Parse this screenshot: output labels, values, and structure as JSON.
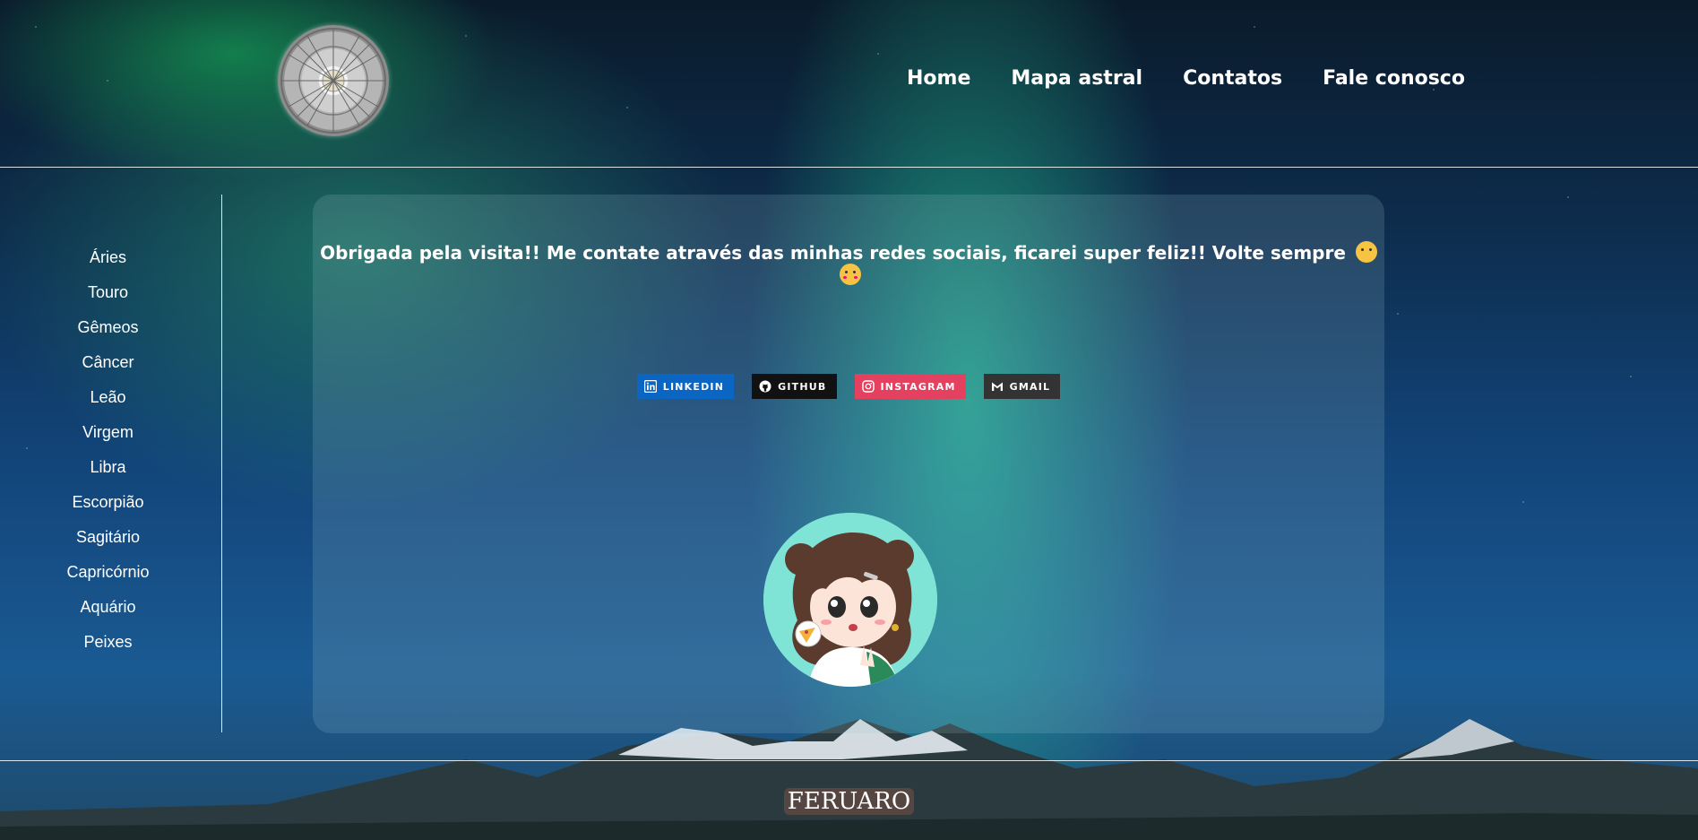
{
  "header": {
    "logo_icon": "zodiac-wheel-icon",
    "nav": [
      {
        "label": "Home"
      },
      {
        "label": "Mapa astral"
      },
      {
        "label": "Contatos"
      },
      {
        "label": "Fale conosco"
      }
    ]
  },
  "sidebar": {
    "items": [
      {
        "label": "Áries"
      },
      {
        "label": "Touro"
      },
      {
        "label": "Gêmeos"
      },
      {
        "label": "Câncer"
      },
      {
        "label": "Leão"
      },
      {
        "label": "Virgem"
      },
      {
        "label": "Libra"
      },
      {
        "label": "Escorpião"
      },
      {
        "label": "Sagitário"
      },
      {
        "label": "Capricórnio"
      },
      {
        "label": "Aquário"
      },
      {
        "label": "Peixes"
      }
    ]
  },
  "main": {
    "message": "Obrigada pela visita!! Me contate através das minhas redes sociais, ficarei super feliz!! Volte sempre",
    "badges": [
      {
        "label": "LINKEDIN",
        "icon": "linkedin-icon",
        "color": "#0a66c2"
      },
      {
        "label": "GITHUB",
        "icon": "github-icon",
        "color": "#111111"
      },
      {
        "label": "INSTAGRAM",
        "icon": "instagram-icon",
        "color": "#e4405f"
      },
      {
        "label": "GMAIL",
        "icon": "gmail-icon",
        "color": "#333333"
      }
    ],
    "avatar_icon": "avatar-illustration"
  },
  "footer": {
    "brand": "FERUARO"
  }
}
